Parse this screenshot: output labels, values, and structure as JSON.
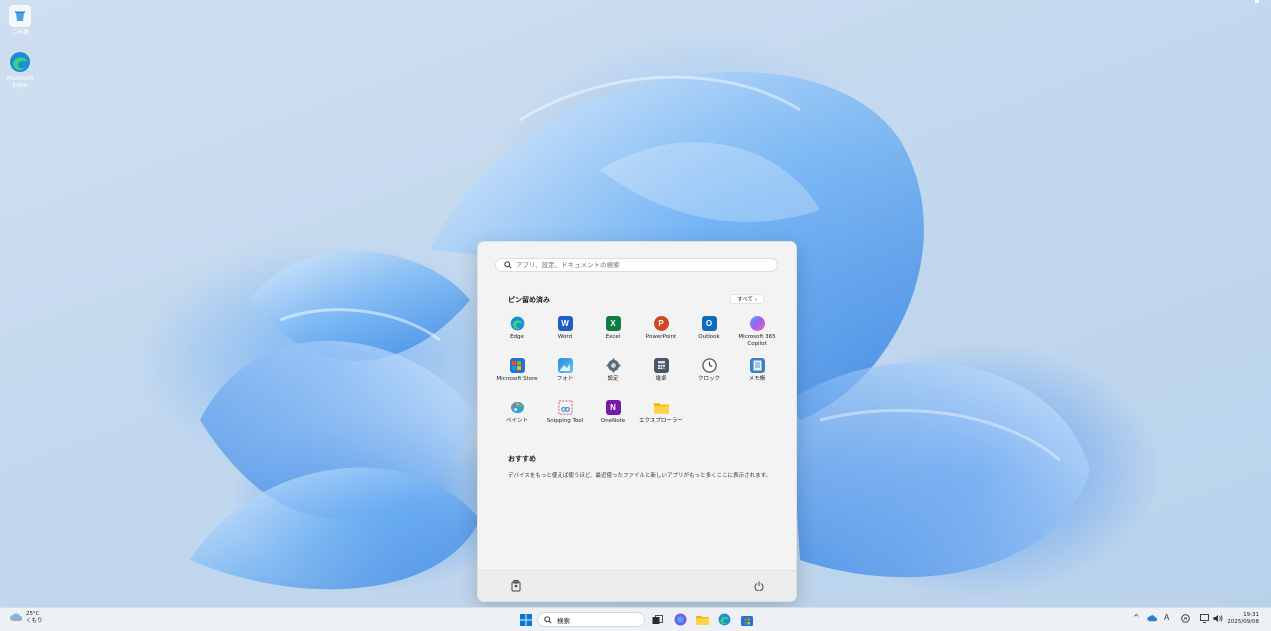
{
  "desktop": {
    "icons": [
      {
        "label": "ごみ箱"
      },
      {
        "label": "Microsoft Edge"
      }
    ]
  },
  "start_menu": {
    "search_placeholder": "アプリ、設定、ドキュメントの検索",
    "pinned_title": "ピン留め済み",
    "all_button": "すべて ›",
    "apps": [
      {
        "label": "Edge",
        "icon": "edge-icon",
        "color": "#1f8fd8"
      },
      {
        "label": "Word",
        "icon": "word-icon",
        "color": "#1f5fbf"
      },
      {
        "label": "Excel",
        "icon": "excel-icon",
        "color": "#107c41"
      },
      {
        "label": "PowerPoint",
        "icon": "powerpoint-icon",
        "color": "#d24726"
      },
      {
        "label": "Outlook",
        "icon": "outlook-icon",
        "color": "#0f6cbd"
      },
      {
        "label": "Microsoft 365 Copilot",
        "icon": "copilot-icon",
        "color": "#8a5cf6"
      },
      {
        "label": "Microsoft Store",
        "icon": "store-icon",
        "color": "#2a6fd6"
      },
      {
        "label": "フォト",
        "icon": "photos-icon",
        "color": "#2b88d8"
      },
      {
        "label": "設定",
        "icon": "settings-icon",
        "color": "#5a6b7c"
      },
      {
        "label": "電卓",
        "icon": "calculator-icon",
        "color": "#4b5563"
      },
      {
        "label": "クロック",
        "icon": "clock-icon",
        "color": "#5b6470"
      },
      {
        "label": "メモ帳",
        "icon": "notepad-icon",
        "color": "#3b82c4"
      },
      {
        "label": "ペイント",
        "icon": "paint-icon",
        "color": "#3aa0d8"
      },
      {
        "label": "Snipping Tool",
        "icon": "snipping-tool-icon",
        "color": "#e05a8a"
      },
      {
        "label": "OneNote",
        "icon": "onenote-icon",
        "color": "#7719aa"
      },
      {
        "label": "エクスプローラー",
        "icon": "file-explorer-icon",
        "color": "#f2b600"
      }
    ],
    "recommended_title": "おすすめ",
    "recommended_text": "デバイスをもっと使えば使うほど、最近使ったファイルと新しいアプリがもっと多くここに表示されます。"
  },
  "taskbar": {
    "weather_temp": "25°C",
    "weather_cond": "くもり",
    "search_label": "検索",
    "ime_label": "A",
    "time": "19:31",
    "date": "2025/09/08"
  }
}
